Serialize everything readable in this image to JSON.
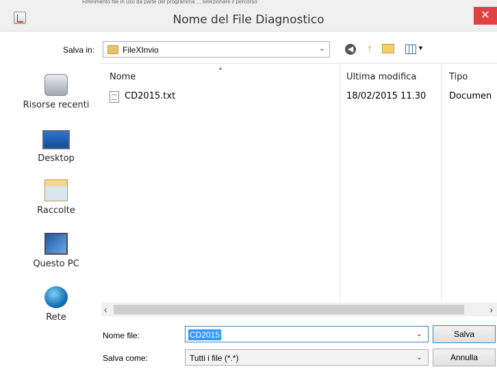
{
  "window": {
    "title": "Nome del File Diagnostico",
    "close_label": "✕",
    "partial_background_text": "Riferimento file in uso da parte del programma ... selezionare il percorso"
  },
  "toolbar": {
    "lookin_label": "Salva in:",
    "lookin_value": "FileXInvio",
    "lookin_caret": "⌄",
    "icons": [
      "back-icon",
      "up-folder-icon",
      "new-folder-icon",
      "view-menu-icon"
    ]
  },
  "places": [
    {
      "label": "Risorse recenti",
      "icon": "recent-places-icon"
    },
    {
      "label": "Desktop",
      "icon": "desktop-icon"
    },
    {
      "label": "Raccolte",
      "icon": "libraries-icon"
    },
    {
      "label": "Questo PC",
      "icon": "this-pc-icon"
    },
    {
      "label": "Rete",
      "icon": "network-icon"
    }
  ],
  "filelist": {
    "columns": [
      "Nome",
      "Ultima modifica",
      "Tipo"
    ],
    "rows": [
      {
        "name": "CD2015.txt",
        "modified": "18/02/2015 11.30",
        "type": "Documen"
      }
    ]
  },
  "form": {
    "filename_label": "Nome file:",
    "filename_value": "CD2015",
    "filetype_label": "Salva come:",
    "filetype_value": "Tutti i file (*.*)"
  },
  "buttons": {
    "save": "Salva",
    "cancel": "Annulla"
  },
  "colors": {
    "selection": "#3399ff",
    "close_button": "#e04343",
    "focus_border": "#3c7fb1"
  }
}
